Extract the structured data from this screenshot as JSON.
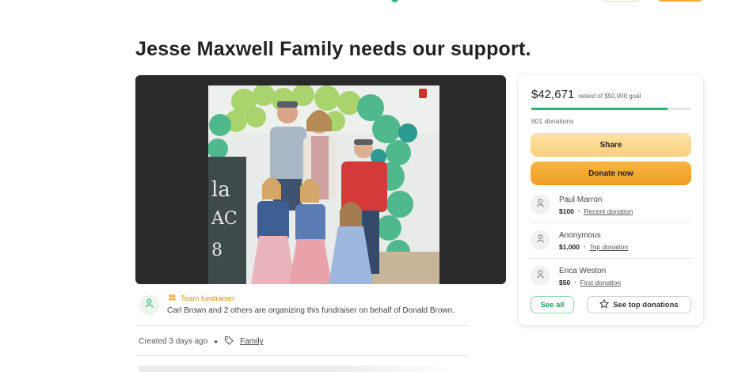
{
  "campaign": {
    "title": "Jesse Maxwell Family needs our support."
  },
  "organizer": {
    "team_label": "Team fundraiser",
    "text": "Carl Brown and 2 others are organizing this fundraiser on behalf of Donald Brown."
  },
  "meta": {
    "created": "Created 3 days ago",
    "category": "Family"
  },
  "donation": {
    "raised": "$42,671",
    "goal_text": "raised of $50,000 goal",
    "progress_fraction": 0.85,
    "count": "601 donations",
    "share_label": "Share",
    "donate_label": "Donate now",
    "donors": [
      {
        "name": "Paul Marron",
        "amount": "$100",
        "tag": "Recent donation"
      },
      {
        "name": "Anonymous",
        "amount": "$1,000",
        "tag": "Top donation"
      },
      {
        "name": "Erica Weston",
        "amount": "$50",
        "tag": "First donation"
      }
    ],
    "see_all_label": "See all",
    "see_top_label": "See top donations"
  },
  "colors": {
    "accent_green": "#2bb673",
    "donate_orange": "#ef9d24",
    "share_yellow": "#f8cf7c",
    "team_gold": "#d2931e"
  },
  "icons": [
    "heart-hand-icon",
    "team-icon",
    "tag-icon",
    "donor-icon",
    "star-icon"
  ]
}
